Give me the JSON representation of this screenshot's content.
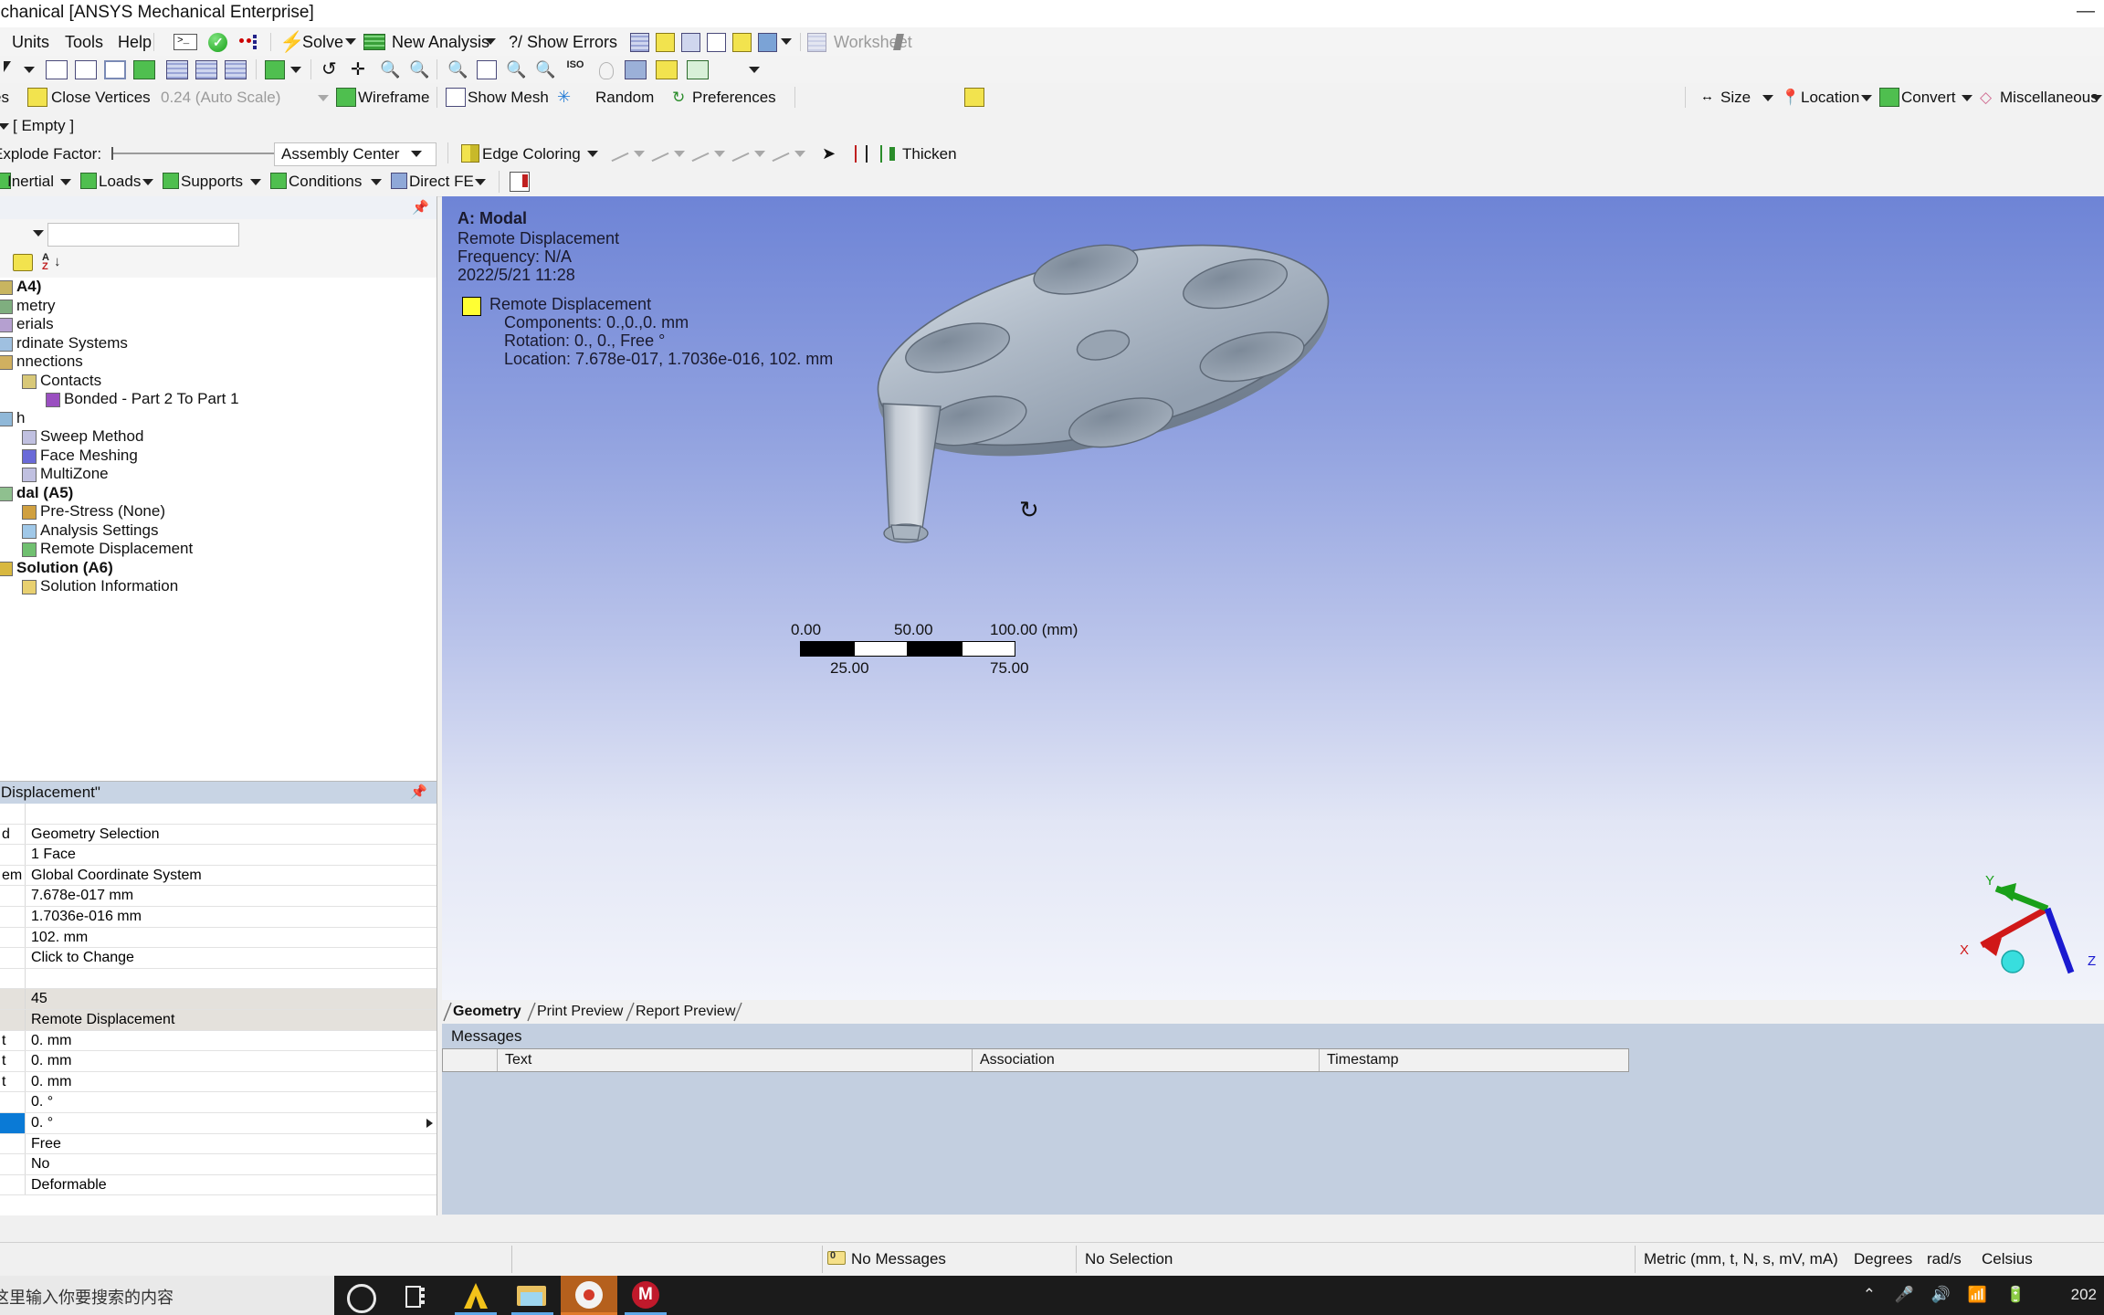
{
  "window": {
    "title": "echanical [ANSYS Mechanical Enterprise]",
    "close_glyph": "—"
  },
  "menubar": {
    "items": [
      "Units",
      "Tools",
      "Help"
    ],
    "icons": [
      "console-icon",
      "green-check-icon",
      "named-selection-icon"
    ],
    "solve_label": "Solve",
    "new_analysis_label": "New Analysis",
    "show_errors_label": "?/ Show Errors",
    "worksheet_label": "Worksheet"
  },
  "toolbar_select": {
    "icons": [
      "cursor-select-icon",
      "select-vertex-icon",
      "select-edge-icon",
      "select-face-icon",
      "select-body-icon",
      "box-select-vertex-icon",
      "box-select-edge-icon",
      "box-select-face-icon",
      "extend-selection-icon",
      "rotate-icon",
      "pan-icon",
      "zoom-icon",
      "zoom-in-icon",
      "zoom-to-fit-icon",
      "box-zoom-icon",
      "magnify-plus-icon",
      "magnify-minus-icon",
      "iso-view-icon",
      "look-at-icon",
      "view-cube-icon",
      "display-settings-icon",
      "annotation-icon"
    ]
  },
  "toolbar_context": {
    "close_vertices_label": "Close Vertices",
    "auto_scale_value": "0.24 (Auto Scale)",
    "wireframe_label": "Wireframe",
    "show_mesh_label": "Show Mesh",
    "random_label": "Random",
    "preferences_label": "Preferences",
    "right_items": [
      {
        "label": "Size",
        "icon": "size-icon"
      },
      {
        "label": "Location",
        "icon": "location-pin-icon"
      },
      {
        "label": "Convert",
        "icon": "convert-icon"
      },
      {
        "label": "Miscellaneous",
        "icon": "miscellaneous-icon"
      }
    ]
  },
  "toolbar_explode": {
    "explode_factor_label": "Explode Factor:",
    "assembly_center_value": "Assembly Center",
    "edge_coloring_label": "Edge Coloring",
    "thicken_label": "Thicken",
    "edge_icons": [
      "edge-0-icon",
      "edge-1-icon",
      "edge-2-icon",
      "edge-3-icon",
      "edge-k-icon",
      "arrow-icon",
      "edge-direction-icon"
    ]
  },
  "toolbar_environment": {
    "items": [
      {
        "label": "Inertial",
        "icon": "inertial-icon"
      },
      {
        "label": "Loads",
        "icon": "loads-icon"
      },
      {
        "label": "Supports",
        "icon": "supports-icon"
      },
      {
        "label": "Conditions",
        "icon": "conditions-icon"
      },
      {
        "label": "Direct FE",
        "icon": "direct-fe-icon"
      }
    ],
    "worksheet_icon": "worksheet-icon"
  },
  "outline": {
    "title_clipped": "",
    "filter_placeholder": "",
    "tree": [
      {
        "label": "A4)",
        "indent": 0,
        "bold": true,
        "icon": "project-icon"
      },
      {
        "label": "metry",
        "indent": 0,
        "bold": false,
        "icon": "geometry-icon"
      },
      {
        "label": "erials",
        "indent": 0,
        "bold": false,
        "icon": "materials-icon"
      },
      {
        "label": "rdinate Systems",
        "indent": 0,
        "bold": false,
        "icon": "coordinate-systems-icon"
      },
      {
        "label": "nnections",
        "indent": 0,
        "bold": false,
        "icon": "connections-icon"
      },
      {
        "label": "Contacts",
        "indent": 1,
        "bold": false,
        "icon": "contacts-folder-icon"
      },
      {
        "label": "Bonded - Part 2 To Part 1",
        "indent": 2,
        "bold": false,
        "icon": "bonded-contact-icon"
      },
      {
        "label": "h",
        "indent": 0,
        "bold": false,
        "icon": "mesh-icon"
      },
      {
        "label": "Sweep Method",
        "indent": 1,
        "bold": false,
        "icon": "sweep-method-icon"
      },
      {
        "label": "Face Meshing",
        "indent": 1,
        "bold": false,
        "icon": "face-meshing-icon"
      },
      {
        "label": "MultiZone",
        "indent": 1,
        "bold": false,
        "icon": "multizone-icon"
      },
      {
        "label": "dal (A5)",
        "indent": 0,
        "bold": true,
        "icon": "modal-icon"
      },
      {
        "label": "Pre-Stress (None)",
        "indent": 1,
        "bold": false,
        "icon": "pre-stress-icon"
      },
      {
        "label": "Analysis Settings",
        "indent": 1,
        "bold": false,
        "icon": "analysis-settings-icon"
      },
      {
        "label": "Remote Displacement",
        "indent": 1,
        "bold": false,
        "icon": "remote-displacement-icon",
        "selected": true
      },
      {
        "label": "Solution (A6)",
        "indent": 0,
        "bold": true,
        "icon": "solution-icon"
      },
      {
        "label": "Solution Information",
        "indent": 1,
        "bold": false,
        "icon": "solution-information-icon"
      }
    ]
  },
  "details": {
    "title": "te Displacement\"",
    "rows": [
      {
        "left": "",
        "right": "",
        "type": "header"
      },
      {
        "left": "d",
        "right": "Geometry Selection",
        "type": "normal"
      },
      {
        "left": "",
        "right": "1 Face",
        "type": "normal"
      },
      {
        "left": "em",
        "right": "Global Coordinate System",
        "type": "normal"
      },
      {
        "left": "",
        "right": "7.678e-017 mm",
        "type": "normal"
      },
      {
        "left": "",
        "right": "1.7036e-016 mm",
        "type": "normal"
      },
      {
        "left": "",
        "right": "102. mm",
        "type": "normal"
      },
      {
        "left": "",
        "right": "Click to Change",
        "type": "normal"
      },
      {
        "left": "",
        "right": "",
        "type": "blank"
      },
      {
        "left": "",
        "right": "45",
        "type": "group"
      },
      {
        "left": "",
        "right": "Remote Displacement",
        "type": "group"
      },
      {
        "left": "t",
        "right": "0. mm",
        "type": "normal"
      },
      {
        "left": "t",
        "right": "0. mm",
        "type": "normal"
      },
      {
        "left": "t",
        "right": "0. mm",
        "type": "normal"
      },
      {
        "left": "",
        "right": "0. °",
        "type": "normal"
      },
      {
        "left": "",
        "right": "0. °",
        "type": "active"
      },
      {
        "left": "",
        "right": "Free",
        "type": "normal"
      },
      {
        "left": "",
        "right": "No",
        "type": "normal"
      },
      {
        "left": "",
        "right": "Deformable",
        "type": "normal"
      }
    ]
  },
  "viewport": {
    "header_lines": [
      "A: Modal",
      "Remote Displacement",
      "Frequency: N/A",
      "2022/5/21 11:28"
    ],
    "legend": {
      "swatch_color": "#ffff33",
      "title": "Remote Displacement",
      "components": "Components: 0.,0.,0. mm",
      "rotation": "Rotation: 0., 0., Free °",
      "location": "Location: 7.678e-017, 1.7036e-016, 102. mm"
    },
    "scalebar": {
      "top_labels": [
        "0.00",
        "50.00",
        "100.00 (mm)"
      ],
      "bottom_labels": [
        "25.00",
        "75.00"
      ]
    },
    "triad": {
      "x": "X",
      "y": "Y",
      "z": "Z"
    },
    "rotate_cursor_icon": "rotate-cursor-icon",
    "tabs": [
      {
        "label": "Geometry",
        "selected": true
      },
      {
        "label": "Print Preview",
        "selected": false
      },
      {
        "label": "Report Preview",
        "selected": false
      }
    ]
  },
  "messages": {
    "title": "Messages",
    "columns": [
      "",
      "Text",
      "Association",
      "Timestamp"
    ]
  },
  "statusbar": {
    "messages": "No Messages",
    "messages_badge": "0",
    "selection": "No Selection",
    "unit_system": "Metric (mm, t, N, s, mV, mA)",
    "angle_unit": "Degrees",
    "rotational_unit": "rad/s",
    "temperature_unit": "Celsius"
  },
  "taskbar": {
    "search_placeholder": "这里输入你要搜索的内容",
    "apps": [
      "cortana-icon",
      "task-view-icon",
      "ansys-icon",
      "file-explorer-icon",
      "chrome-icon",
      "mendeley-icon"
    ],
    "tray": [
      "chevron-up-icon",
      "microphone-icon",
      "speaker-icon",
      "network-icon",
      "battery-icon"
    ],
    "clock": "202"
  }
}
